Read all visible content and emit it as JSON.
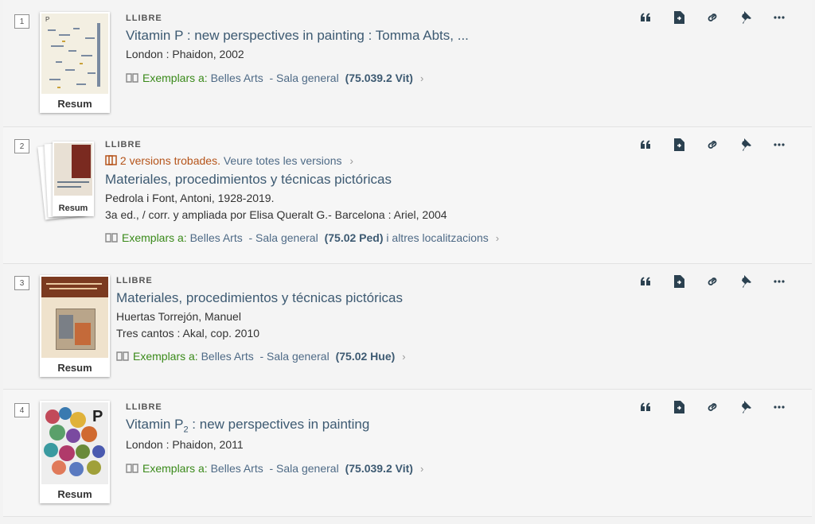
{
  "colors": {
    "title": "#3d5a72",
    "available": "#3a8a1a",
    "versions": "#b5541a",
    "icon": "#2b4150"
  },
  "action_icons": [
    "quote-icon",
    "export-document-icon",
    "permalink-icon",
    "pin-icon",
    "more-icon"
  ],
  "results": [
    {
      "number": "1",
      "type": "LLIBRE",
      "title": "Vitamin P : new perspectives in painting : Tomma Abts, ...",
      "lines": [
        "London : Phaidon, 2002"
      ],
      "avail_label": "Exemplars a:",
      "location": " Belles Arts  - Sala general ",
      "call_number": "(75.039.2 Vit)",
      "extra": "",
      "resum": "Resum"
    },
    {
      "number": "2",
      "type": "LLIBRE",
      "versions_text": "2 versions trobades.",
      "versions_link": "Veure totes les versions",
      "title": "Materiales, procedimientos y técnicas pictóricas",
      "lines": [
        "Pedrola i Font, Antoni, 1928-2019.",
        "3a ed., / corr. y ampliada por Elisa Queralt G.- Barcelona : Ariel, 2004"
      ],
      "avail_label": "Exemplars a:",
      "location": " Belles Arts  - Sala general ",
      "call_number": "(75.02 Ped)",
      "extra": " i altres localitzacions",
      "resum": "Resum"
    },
    {
      "number": "3",
      "type": "LLIBRE",
      "title": "Materiales, procedimientos y técnicas pictóricas",
      "lines": [
        "Huertas Torrejón, Manuel",
        "Tres cantos : Akal, cop. 2010"
      ],
      "avail_label": "Exemplars a:",
      "location": " Belles Arts  - Sala general ",
      "call_number": "(75.02 Hue)",
      "extra": "",
      "resum": "Resum"
    },
    {
      "number": "4",
      "type": "LLIBRE",
      "title_main": "Vitamin P",
      "title_sub": "2",
      "title_rest": " : new perspectives in painting",
      "lines": [
        "London : Phaidon, 2011"
      ],
      "avail_label": "Exemplars a:",
      "location": " Belles Arts  - Sala general ",
      "call_number": "(75.039.2 Vit)",
      "extra": "",
      "resum": "Resum"
    }
  ]
}
